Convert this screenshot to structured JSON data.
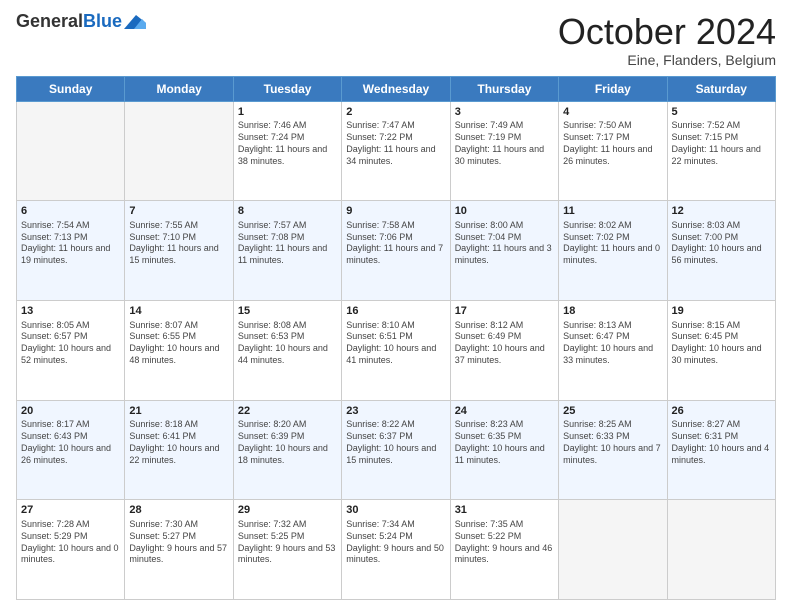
{
  "header": {
    "logo_general": "General",
    "logo_blue": "Blue",
    "month_title": "October 2024",
    "location": "Eine, Flanders, Belgium"
  },
  "weekdays": [
    "Sunday",
    "Monday",
    "Tuesday",
    "Wednesday",
    "Thursday",
    "Friday",
    "Saturday"
  ],
  "weeks": [
    [
      {
        "day": "",
        "empty": true
      },
      {
        "day": "",
        "empty": true
      },
      {
        "day": "1",
        "sunrise": "Sunrise: 7:46 AM",
        "sunset": "Sunset: 7:24 PM",
        "daylight": "Daylight: 11 hours and 38 minutes."
      },
      {
        "day": "2",
        "sunrise": "Sunrise: 7:47 AM",
        "sunset": "Sunset: 7:22 PM",
        "daylight": "Daylight: 11 hours and 34 minutes."
      },
      {
        "day": "3",
        "sunrise": "Sunrise: 7:49 AM",
        "sunset": "Sunset: 7:19 PM",
        "daylight": "Daylight: 11 hours and 30 minutes."
      },
      {
        "day": "4",
        "sunrise": "Sunrise: 7:50 AM",
        "sunset": "Sunset: 7:17 PM",
        "daylight": "Daylight: 11 hours and 26 minutes."
      },
      {
        "day": "5",
        "sunrise": "Sunrise: 7:52 AM",
        "sunset": "Sunset: 7:15 PM",
        "daylight": "Daylight: 11 hours and 22 minutes."
      }
    ],
    [
      {
        "day": "6",
        "sunrise": "Sunrise: 7:54 AM",
        "sunset": "Sunset: 7:13 PM",
        "daylight": "Daylight: 11 hours and 19 minutes."
      },
      {
        "day": "7",
        "sunrise": "Sunrise: 7:55 AM",
        "sunset": "Sunset: 7:10 PM",
        "daylight": "Daylight: 11 hours and 15 minutes."
      },
      {
        "day": "8",
        "sunrise": "Sunrise: 7:57 AM",
        "sunset": "Sunset: 7:08 PM",
        "daylight": "Daylight: 11 hours and 11 minutes."
      },
      {
        "day": "9",
        "sunrise": "Sunrise: 7:58 AM",
        "sunset": "Sunset: 7:06 PM",
        "daylight": "Daylight: 11 hours and 7 minutes."
      },
      {
        "day": "10",
        "sunrise": "Sunrise: 8:00 AM",
        "sunset": "Sunset: 7:04 PM",
        "daylight": "Daylight: 11 hours and 3 minutes."
      },
      {
        "day": "11",
        "sunrise": "Sunrise: 8:02 AM",
        "sunset": "Sunset: 7:02 PM",
        "daylight": "Daylight: 11 hours and 0 minutes."
      },
      {
        "day": "12",
        "sunrise": "Sunrise: 8:03 AM",
        "sunset": "Sunset: 7:00 PM",
        "daylight": "Daylight: 10 hours and 56 minutes."
      }
    ],
    [
      {
        "day": "13",
        "sunrise": "Sunrise: 8:05 AM",
        "sunset": "Sunset: 6:57 PM",
        "daylight": "Daylight: 10 hours and 52 minutes."
      },
      {
        "day": "14",
        "sunrise": "Sunrise: 8:07 AM",
        "sunset": "Sunset: 6:55 PM",
        "daylight": "Daylight: 10 hours and 48 minutes."
      },
      {
        "day": "15",
        "sunrise": "Sunrise: 8:08 AM",
        "sunset": "Sunset: 6:53 PM",
        "daylight": "Daylight: 10 hours and 44 minutes."
      },
      {
        "day": "16",
        "sunrise": "Sunrise: 8:10 AM",
        "sunset": "Sunset: 6:51 PM",
        "daylight": "Daylight: 10 hours and 41 minutes."
      },
      {
        "day": "17",
        "sunrise": "Sunrise: 8:12 AM",
        "sunset": "Sunset: 6:49 PM",
        "daylight": "Daylight: 10 hours and 37 minutes."
      },
      {
        "day": "18",
        "sunrise": "Sunrise: 8:13 AM",
        "sunset": "Sunset: 6:47 PM",
        "daylight": "Daylight: 10 hours and 33 minutes."
      },
      {
        "day": "19",
        "sunrise": "Sunrise: 8:15 AM",
        "sunset": "Sunset: 6:45 PM",
        "daylight": "Daylight: 10 hours and 30 minutes."
      }
    ],
    [
      {
        "day": "20",
        "sunrise": "Sunrise: 8:17 AM",
        "sunset": "Sunset: 6:43 PM",
        "daylight": "Daylight: 10 hours and 26 minutes."
      },
      {
        "day": "21",
        "sunrise": "Sunrise: 8:18 AM",
        "sunset": "Sunset: 6:41 PM",
        "daylight": "Daylight: 10 hours and 22 minutes."
      },
      {
        "day": "22",
        "sunrise": "Sunrise: 8:20 AM",
        "sunset": "Sunset: 6:39 PM",
        "daylight": "Daylight: 10 hours and 18 minutes."
      },
      {
        "day": "23",
        "sunrise": "Sunrise: 8:22 AM",
        "sunset": "Sunset: 6:37 PM",
        "daylight": "Daylight: 10 hours and 15 minutes."
      },
      {
        "day": "24",
        "sunrise": "Sunrise: 8:23 AM",
        "sunset": "Sunset: 6:35 PM",
        "daylight": "Daylight: 10 hours and 11 minutes."
      },
      {
        "day": "25",
        "sunrise": "Sunrise: 8:25 AM",
        "sunset": "Sunset: 6:33 PM",
        "daylight": "Daylight: 10 hours and 7 minutes."
      },
      {
        "day": "26",
        "sunrise": "Sunrise: 8:27 AM",
        "sunset": "Sunset: 6:31 PM",
        "daylight": "Daylight: 10 hours and 4 minutes."
      }
    ],
    [
      {
        "day": "27",
        "sunrise": "Sunrise: 7:28 AM",
        "sunset": "Sunset: 5:29 PM",
        "daylight": "Daylight: 10 hours and 0 minutes."
      },
      {
        "day": "28",
        "sunrise": "Sunrise: 7:30 AM",
        "sunset": "Sunset: 5:27 PM",
        "daylight": "Daylight: 9 hours and 57 minutes."
      },
      {
        "day": "29",
        "sunrise": "Sunrise: 7:32 AM",
        "sunset": "Sunset: 5:25 PM",
        "daylight": "Daylight: 9 hours and 53 minutes."
      },
      {
        "day": "30",
        "sunrise": "Sunrise: 7:34 AM",
        "sunset": "Sunset: 5:24 PM",
        "daylight": "Daylight: 9 hours and 50 minutes."
      },
      {
        "day": "31",
        "sunrise": "Sunrise: 7:35 AM",
        "sunset": "Sunset: 5:22 PM",
        "daylight": "Daylight: 9 hours and 46 minutes."
      },
      {
        "day": "",
        "empty": true
      },
      {
        "day": "",
        "empty": true
      }
    ]
  ]
}
